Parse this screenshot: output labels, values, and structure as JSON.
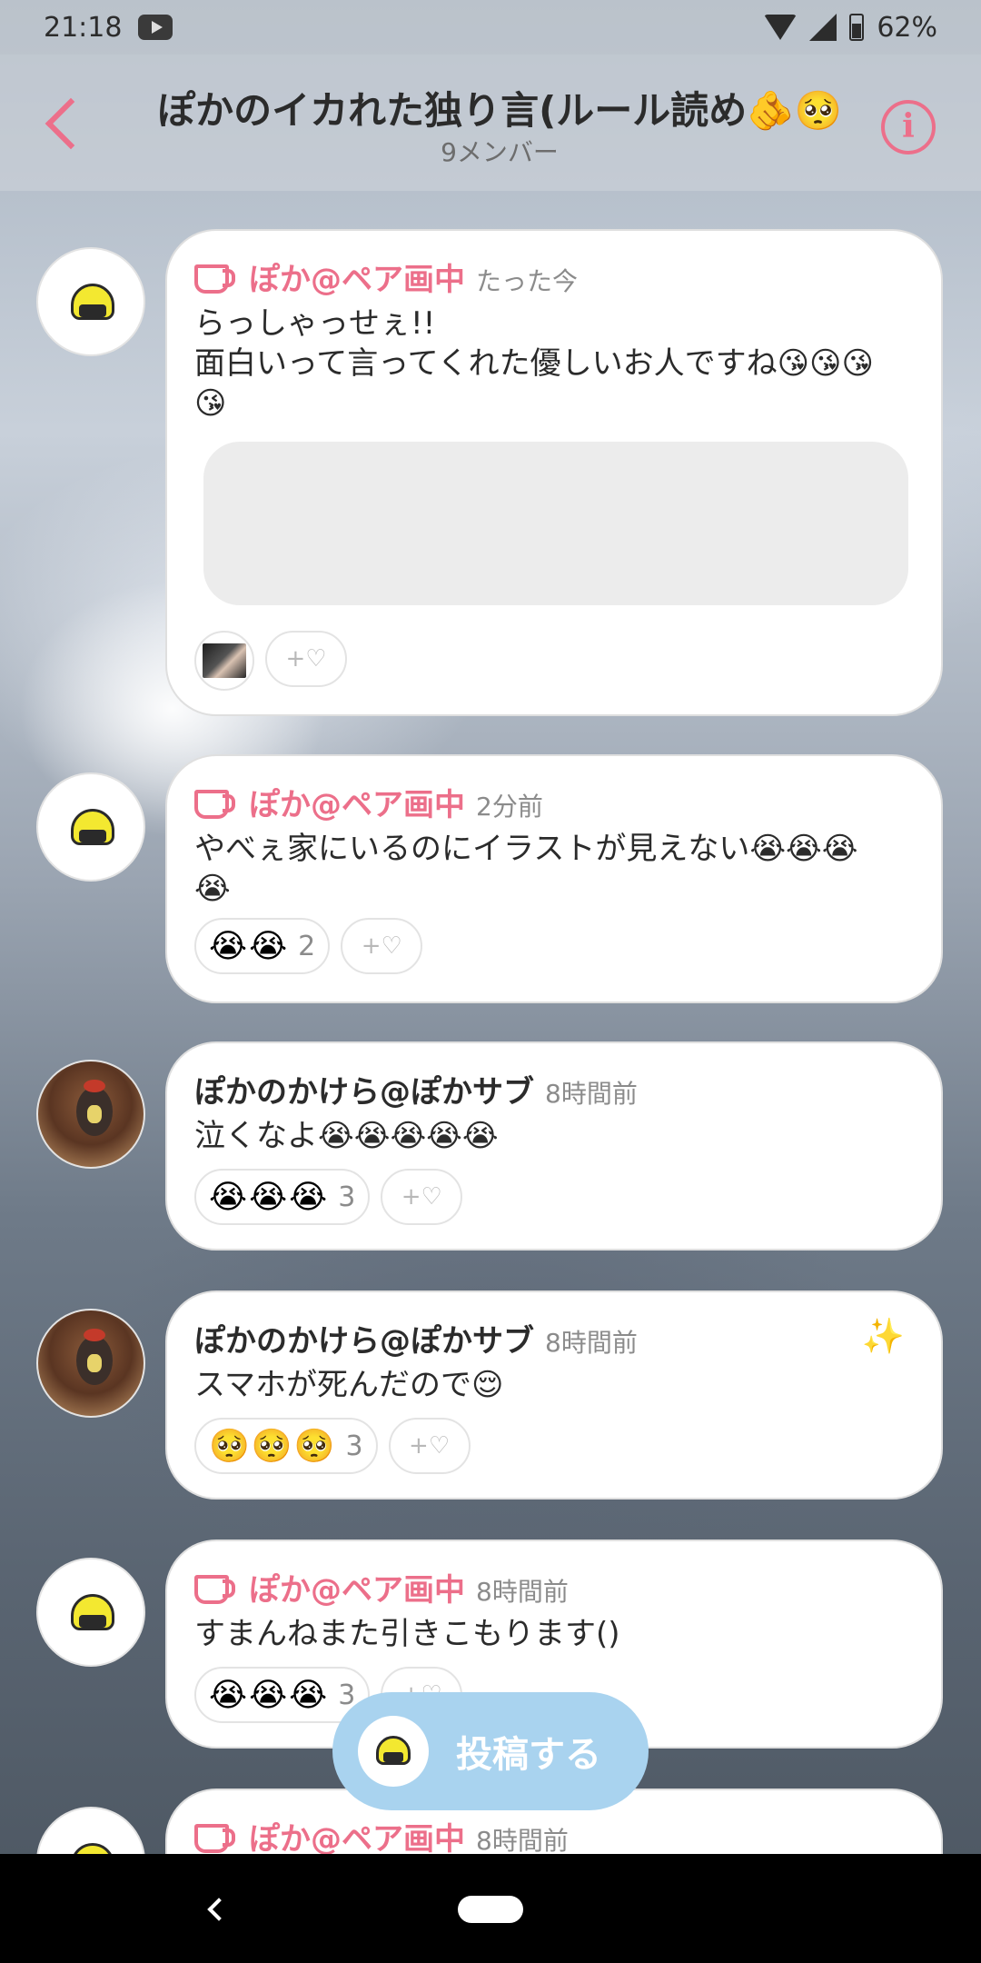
{
  "status_bar": {
    "time": "21:18",
    "battery": "62%",
    "icons": [
      "youtube-icon",
      "wifi-icon",
      "signal-icon",
      "battery-icon"
    ]
  },
  "header": {
    "title": "ぽかのイカれた独り言(ルール読め🫵🥺",
    "subtitle": "9メンバー",
    "back_icon": "chevron-left-icon",
    "info_icon": "info-icon",
    "accent_color": "#ec6f8a"
  },
  "messages": [
    {
      "author": "ぽか@ペア画中",
      "time": "たった今",
      "text": "らっしゃっせぇ!!\n面白いって言ってくれた優しいお人ですね😘😘😘\n😘",
      "add_reaction_label": "+♡"
    },
    {
      "author": "ぽか@ペア画中",
      "time": "2分前",
      "text": "やべぇ家にいるのにイラストが見えない😭😭😭\n😭",
      "reaction_emojis": "😭😭",
      "reaction_count": "2",
      "add_reaction_label": "+♡"
    },
    {
      "author": "ぽかのかけら@ぽかサブ",
      "time": "8時間前",
      "text": "泣くなよ😭😭😭😭😭",
      "reaction_emojis": "😭😭😭",
      "reaction_count": "3",
      "add_reaction_label": "+♡"
    },
    {
      "author": "ぽかのかけら@ぽかサブ",
      "time": "8時間前",
      "text": "スマホが死んだので😌",
      "reaction_emojis": "🥺🥺🥺",
      "reaction_count": "3",
      "add_reaction_label": "+♡",
      "badge": "✨"
    },
    {
      "author": "ぽか@ペア画中",
      "time": "8時間前",
      "text": "すまんねまた引きこもります()",
      "reaction_emojis": "😭😭😭",
      "reaction_count": "3",
      "add_reaction_label": "+♡"
    },
    {
      "author": "ぽか@ペア画中",
      "time": "8時間前"
    }
  ],
  "post_button": {
    "label": "投稿する",
    "color": "#a9d3ef"
  }
}
